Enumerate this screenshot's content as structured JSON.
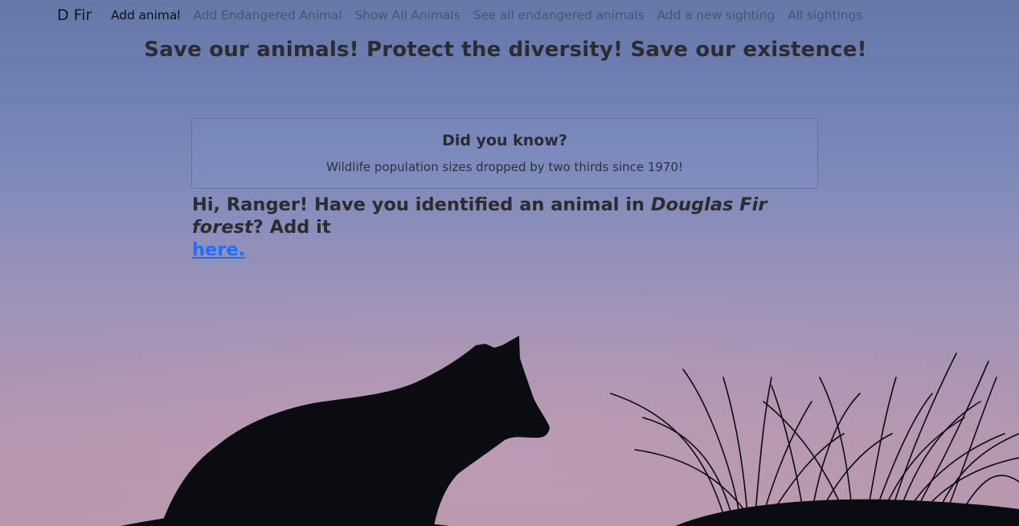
{
  "navbar": {
    "brand": "D Fir",
    "links": [
      {
        "label": "Add animal",
        "active": true
      },
      {
        "label": "Add Endangered Animal",
        "active": false
      },
      {
        "label": "Show All Animals",
        "active": false
      },
      {
        "label": "See all endangered animals",
        "active": false
      },
      {
        "label": "Add a new sighting",
        "active": false
      },
      {
        "label": "All sightings",
        "active": false
      }
    ]
  },
  "headline": "Save our animals! Protect the diversity! Save our existence!",
  "fact_card": {
    "title": "Did you know?",
    "text": "Wildlife population sizes dropped by two thirds since 1970!"
  },
  "ranger_message": {
    "prefix": "Hi, Ranger! Have you identified an animal in ",
    "forest_name": "Douglas Fir forest",
    "suffix": "? Add it ",
    "link_text": "here."
  },
  "colors": {
    "link": "#1f6fff",
    "silhouette": "#0b0b12"
  },
  "background": {
    "scene": "fox silhouette at dusk with grass"
  }
}
